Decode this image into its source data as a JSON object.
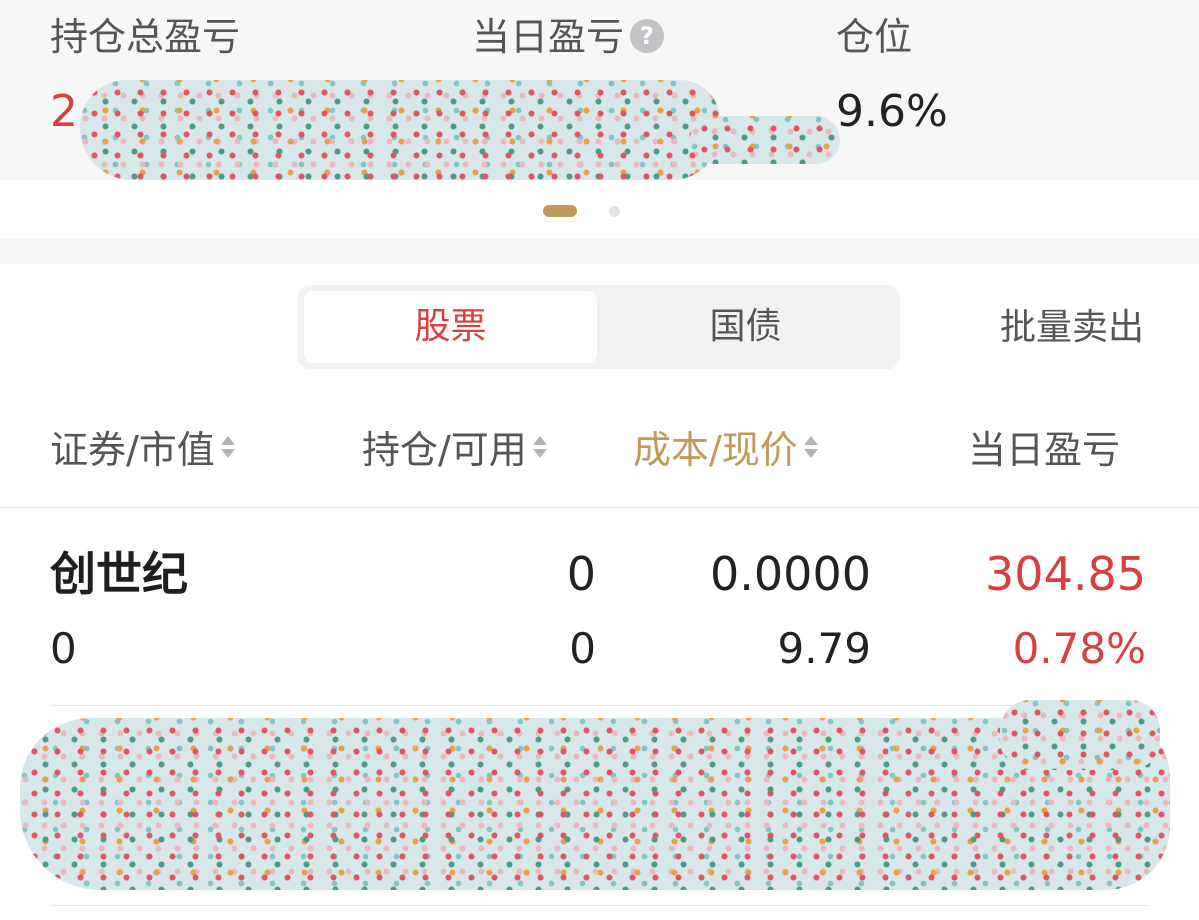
{
  "summary": {
    "total_pnl_label": "持仓总盈亏",
    "total_pnl_value_visible": "2",
    "daily_pnl_label": "当日盈亏",
    "help_glyph": "?",
    "position_label": "仓位",
    "position_value": "9.6%"
  },
  "pager": {
    "active_page": 1,
    "total_pages": 2
  },
  "tabs": [
    {
      "label": "股票",
      "active": true
    },
    {
      "label": "国债",
      "active": false
    }
  ],
  "batch_sell_label": "批量卖出",
  "columns": [
    {
      "label": "证券/市值",
      "sortable": true
    },
    {
      "label": "持仓/可用",
      "sortable": true
    },
    {
      "label": "成本/现价",
      "sortable": true,
      "highlighted": true
    },
    {
      "label": "当日盈亏",
      "sortable": false
    }
  ],
  "holdings": [
    {
      "name": "创世纪",
      "market_value": "0",
      "position": "0",
      "available": "0",
      "cost": "0.0000",
      "price": "9.79",
      "daily_pnl": "304.85",
      "daily_pnl_pct": "0.78%"
    }
  ],
  "colors": {
    "up_red": "#d8403f",
    "accent_gold": "#c19a59",
    "summary_bg": "#f7f7f8"
  }
}
